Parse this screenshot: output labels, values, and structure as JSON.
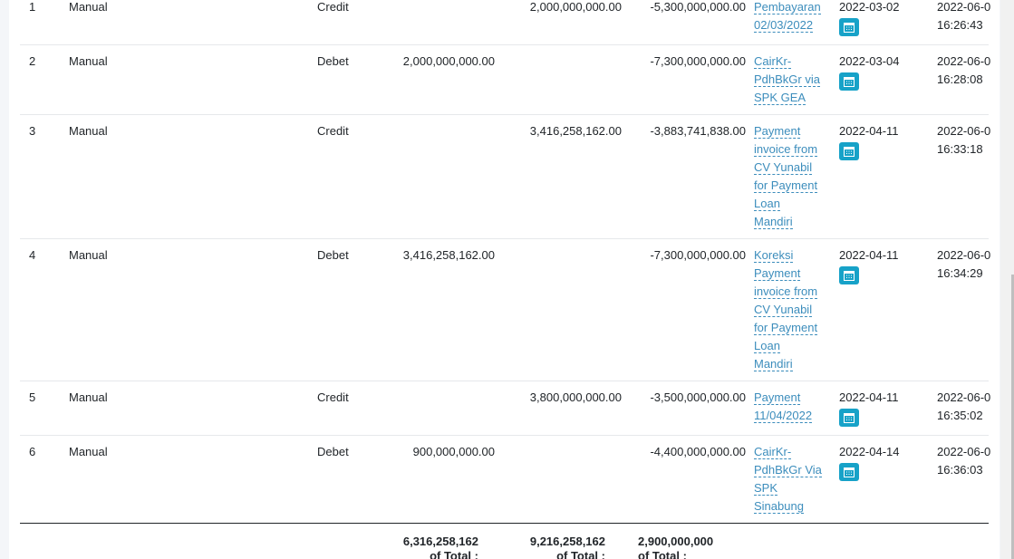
{
  "rows": [
    {
      "no": "1",
      "type": "Manual",
      "dc": "Credit",
      "debet": "",
      "credit": "2,000,000,000.00",
      "balance": "-5,300,000,000.00",
      "desc": [
        "Pembayaran",
        "02/03/2022"
      ],
      "date": "2022-03-02",
      "created": [
        "2022-06-0",
        "16:26:43"
      ]
    },
    {
      "no": "2",
      "type": "Manual",
      "dc": "Debet",
      "debet": "2,000,000,000.00",
      "credit": "",
      "balance": "-7,300,000,000.00",
      "desc": [
        "CairKr-",
        "PdhBkGr via",
        "SPK GEA"
      ],
      "date": "2022-03-04",
      "created": [
        "2022-06-0",
        "16:28:08"
      ]
    },
    {
      "no": "3",
      "type": "Manual",
      "dc": "Credit",
      "debet": "",
      "credit": "3,416,258,162.00",
      "balance": "-3,883,741,838.00",
      "desc": [
        "Payment",
        "invoice from",
        "CV Yunabil",
        "for Payment",
        "Loan",
        "Mandiri"
      ],
      "date": "2022-04-11",
      "created": [
        "2022-06-0",
        "16:33:18"
      ]
    },
    {
      "no": "4",
      "type": "Manual",
      "dc": "Debet",
      "debet": "3,416,258,162.00",
      "credit": "",
      "balance": "-7,300,000,000.00",
      "desc": [
        "Koreksi",
        "Payment",
        "invoice from",
        "CV Yunabil",
        "for Payment",
        "Loan",
        "Mandiri"
      ],
      "date": "2022-04-11",
      "created": [
        "2022-06-0",
        "16:34:29"
      ]
    },
    {
      "no": "5",
      "type": "Manual",
      "dc": "Credit",
      "debet": "",
      "credit": "3,800,000,000.00",
      "balance": "-3,500,000,000.00",
      "desc": [
        "Payment",
        "11/04/2022"
      ],
      "date": "2022-04-11",
      "created": [
        "2022-06-0",
        "16:35:02"
      ]
    },
    {
      "no": "6",
      "type": "Manual",
      "dc": "Debet",
      "debet": "900,000,000.00",
      "credit": "",
      "balance": "-4,400,000,000.00",
      "desc": [
        "CairKr-",
        "PdhBkGr Via",
        "SPK",
        "Sinabung"
      ],
      "date": "2022-04-14",
      "created": [
        "2022-06-0",
        "16:36:03"
      ]
    }
  ],
  "totals": {
    "debet": "6,316,258,162",
    "credit": "9,216,258,162",
    "balance": "2,900,000,000",
    "suffix": "of Total :"
  },
  "icons": {
    "calendar": "calendar-icon"
  },
  "colors": {
    "link": "#3c8dbc",
    "calendar_button": "#17a2c8"
  }
}
